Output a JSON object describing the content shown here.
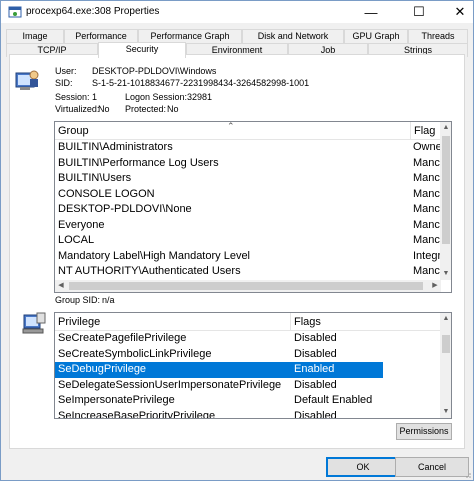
{
  "window": {
    "title": "procexp64.exe:308 Properties"
  },
  "titlebar_buttons": {
    "minimize": "—",
    "maximize": "☐",
    "close": "✕"
  },
  "tabs_row1": [
    "Image",
    "Performance",
    "Performance Graph",
    "Disk and Network",
    "GPU Graph",
    "Threads"
  ],
  "tabs_row2": [
    "TCP/IP",
    "Security",
    "Environment",
    "Job",
    "Strings"
  ],
  "active_tab": "Security",
  "security": {
    "user_label": "User:",
    "user_value": "DESKTOP-PDLDOVI\\Windows",
    "sid_label": "SID:",
    "sid_value": "S-1-5-21-1018834677-2231998434-3264582998-1001",
    "session_label": "Session:",
    "session_value": "1",
    "logon_session_label": "Logon Session:",
    "logon_session_value": "32981",
    "virtualized_label": "Virtualized:",
    "virtualized_value": "No",
    "protected_label": "Protected:",
    "protected_value": "No",
    "group_sid_label": "Group SID:",
    "group_sid_value": "n/a"
  },
  "groups": {
    "headers": [
      "Group",
      "Flag"
    ],
    "rows": [
      [
        "BUILTIN\\Administrators",
        "Owne"
      ],
      [
        "BUILTIN\\Performance Log Users",
        "Manc"
      ],
      [
        "BUILTIN\\Users",
        "Manc"
      ],
      [
        "CONSOLE LOGON",
        "Manc"
      ],
      [
        "DESKTOP-PDLDOVI\\None",
        "Manc"
      ],
      [
        "Everyone",
        "Manc"
      ],
      [
        "LOCAL",
        "Manc"
      ],
      [
        "Mandatory Label\\High Mandatory Level",
        "Integr"
      ],
      [
        "NT AUTHORITY\\Authenticated Users",
        "Manc"
      ]
    ]
  },
  "privileges": {
    "headers": [
      "Privilege",
      "Flags"
    ],
    "rows": [
      [
        "SeCreatePagefilePrivilege",
        "Disabled"
      ],
      [
        "SeCreateSymbolicLinkPrivilege",
        "Disabled"
      ],
      [
        "SeDebugPrivilege",
        "Enabled"
      ],
      [
        "SeDelegateSessionUserImpersonatePrivilege",
        "Disabled"
      ],
      [
        "SeImpersonatePrivilege",
        "Default Enabled"
      ],
      [
        "SeIncreaseBasePriorityPrivilege",
        "Disabled"
      ]
    ],
    "selected_index": 2
  },
  "buttons": {
    "permissions": "Permissions",
    "ok": "OK",
    "cancel": "Cancel"
  },
  "scroll_arrows": {
    "up": "▲",
    "down": "▼",
    "left": "◀",
    "right": "▶",
    "sort": "⌃"
  },
  "colors": {
    "selection": "#0078d7",
    "accent_border": "#0078d7"
  }
}
